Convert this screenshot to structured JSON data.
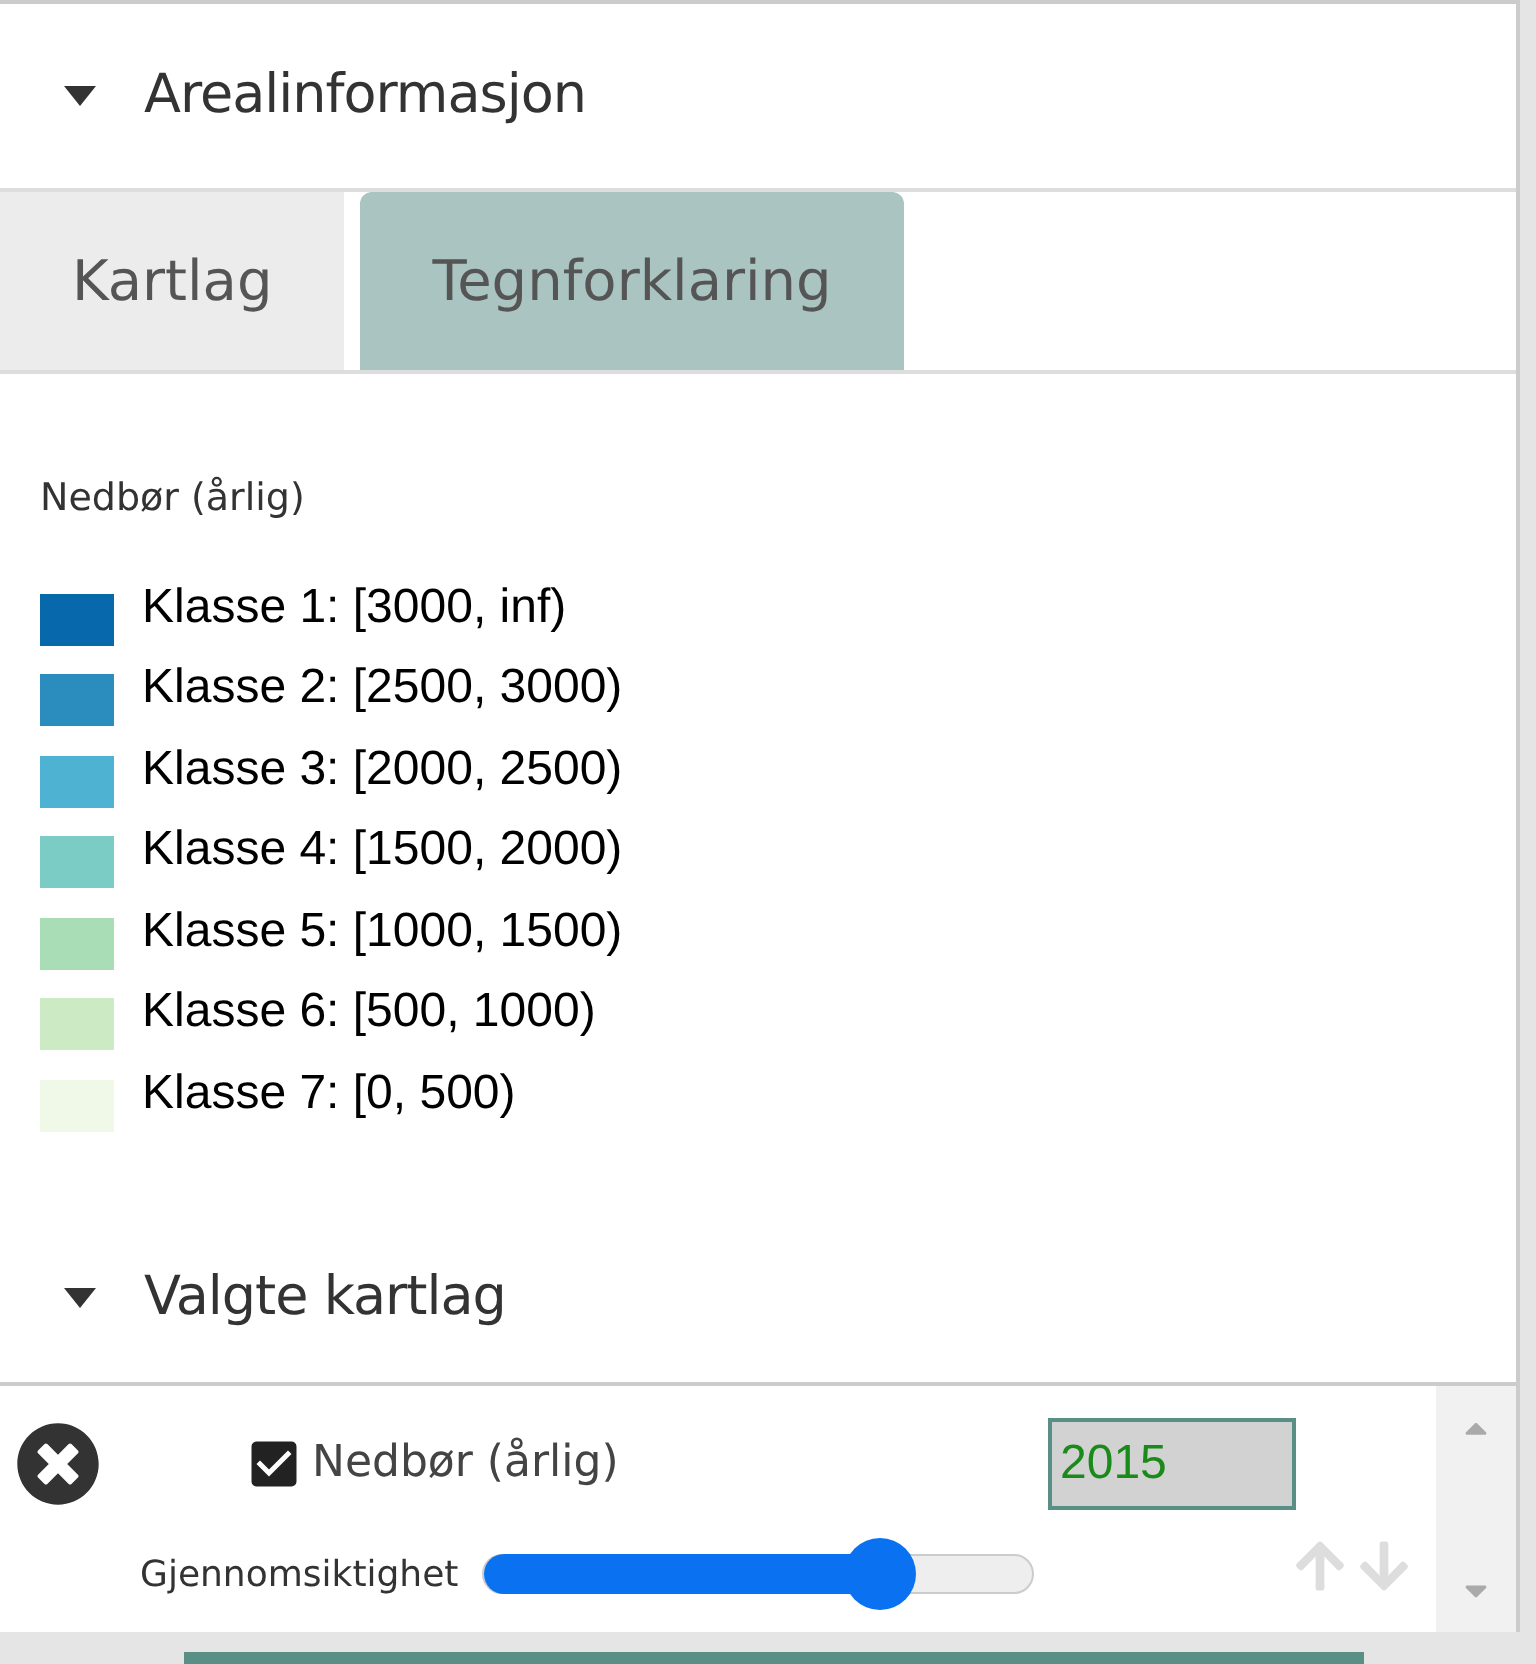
{
  "section": {
    "title": "Arealinformasjon",
    "expanded": true
  },
  "tabs": [
    {
      "label": "Kartlag",
      "selected": false
    },
    {
      "label": "Tegnforklaring",
      "selected": true
    }
  ],
  "legend": {
    "title": "Nedbør (årlig)",
    "items": [
      {
        "label": "Klasse 1: [3000, inf)",
        "color": "#0868ac"
      },
      {
        "label": "Klasse 2: [2500, 3000)",
        "color": "#2b8cbe"
      },
      {
        "label": "Klasse 3: [2000, 2500)",
        "color": "#4eb3d3"
      },
      {
        "label": "Klasse 4: [1500, 2000)",
        "color": "#7bccc4"
      },
      {
        "label": "Klasse 5: [1000, 1500)",
        "color": "#a8ddb5"
      },
      {
        "label": "Klasse 6: [500, 1000)",
        "color": "#ccebc5"
      },
      {
        "label": "Klasse 7: [0, 500)",
        "color": "#f0f9e8"
      }
    ]
  },
  "selected_section": {
    "title": "Valgte kartlag",
    "expanded": true
  },
  "layers": [
    {
      "name": "Nedbør (årlig)",
      "checked": true,
      "year": "2015",
      "opacity_label": "Gjennomsiktighet",
      "level": 0.72
    }
  ]
}
